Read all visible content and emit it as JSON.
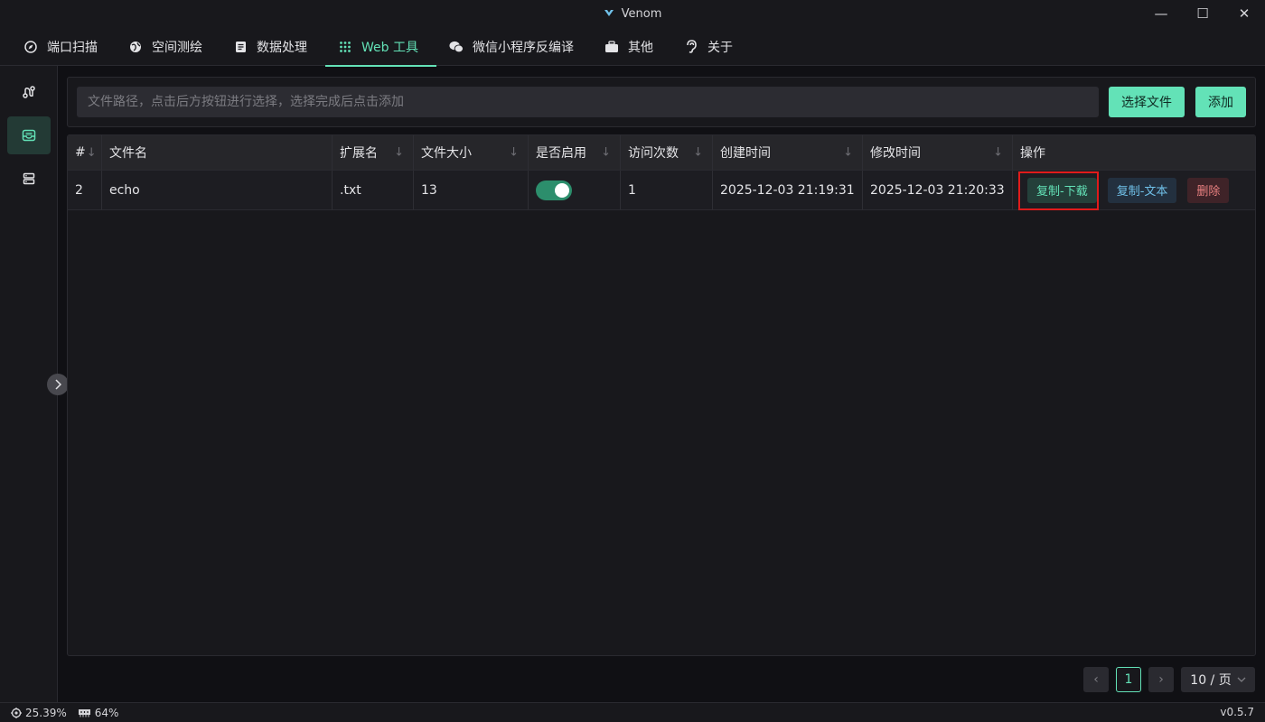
{
  "window": {
    "title": "Venom",
    "controls": {
      "minimize": "—",
      "maximize": "☐",
      "close": "✕"
    }
  },
  "tabs": [
    {
      "label": "端口扫描",
      "icon": "compass-icon"
    },
    {
      "label": "空间测绘",
      "icon": "globe-icon"
    },
    {
      "label": "数据处理",
      "icon": "document-icon"
    },
    {
      "label": "Web 工具",
      "icon": "grid-icon",
      "active": true
    },
    {
      "label": "微信小程序反编译",
      "icon": "wechat-icon"
    },
    {
      "label": "其他",
      "icon": "briefcase-icon"
    },
    {
      "label": "关于",
      "icon": "ear-icon"
    }
  ],
  "sidebar": {
    "items": [
      {
        "icon": "route-icon"
      },
      {
        "icon": "inbox-icon",
        "active": true
      },
      {
        "icon": "server-icon"
      }
    ]
  },
  "upload": {
    "placeholder": "文件路径，点击后方按钮进行选择，选择完成后点击添加",
    "select_label": "选择文件",
    "add_label": "添加"
  },
  "table": {
    "columns": [
      "#",
      "文件名",
      "扩展名",
      "文件大小",
      "是否启用",
      "访问次数",
      "创建时间",
      "修改时间",
      "操作"
    ],
    "rows": [
      {
        "index": "2",
        "name": "echo",
        "ext": ".txt",
        "size": "13",
        "enabled": true,
        "visits": "1",
        "created": "2025-12-03 21:19:31",
        "modified": "2025-12-03 21:20:33",
        "actions": {
          "copy_download": "复制-下载",
          "copy_text": "复制-文本",
          "delete": "删除"
        }
      }
    ]
  },
  "pagination": {
    "current": "1",
    "page_size": "10 / 页",
    "prev": "‹",
    "next": "›"
  },
  "status": {
    "cpu": "25.39%",
    "memory": "64%",
    "version": "v0.5.7"
  },
  "colors": {
    "accent": "#63e2b7",
    "danger": "#e88080",
    "info": "#70c0e8",
    "highlight": "#e01b1b"
  }
}
